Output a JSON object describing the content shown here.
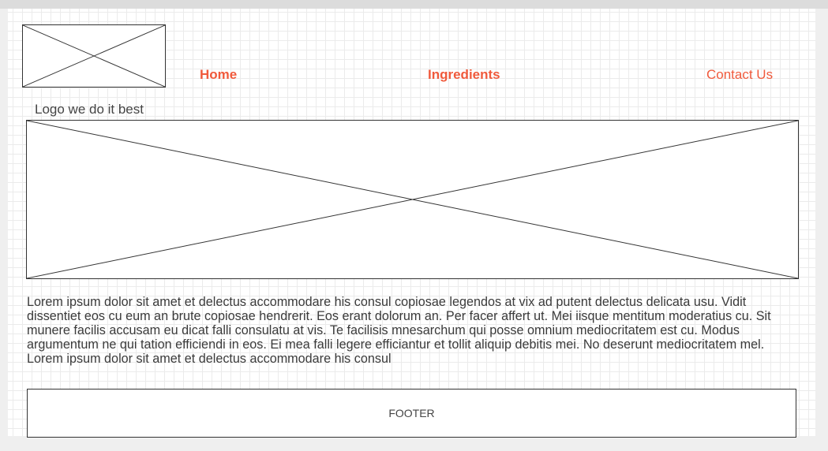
{
  "nav": {
    "home": "Home",
    "ingredients": "Ingredients",
    "contact": "Contact Us"
  },
  "logo": {
    "caption": "Logo we do it best"
  },
  "main": {
    "body": "Lorem ipsum dolor sit amet et delectus accommodare his consul copiosae legendos at vix ad putent delectus delicata usu. Vidit dissentiet eos cu eum an brute copiosae hendrerit. Eos erant dolorum an. Per facer affert ut. Mei iisque mentitum moderatius cu. Sit munere facilis accusam eu dicat falli consulatu at vis. Te facilisis mnesarchum qui posse omnium mediocritatem est cu. Modus argumentum ne qui tation efficiendi in eos. Ei mea falli legere efficiantur et tollit aliquip debitis mei. No deserunt mediocritatem mel. Lorem ipsum dolor sit amet et delectus accommodare his consul"
  },
  "footer": {
    "label": "FOOTER"
  },
  "colors": {
    "nav_link": "#f05a3c",
    "grid": "#ebebeb"
  }
}
